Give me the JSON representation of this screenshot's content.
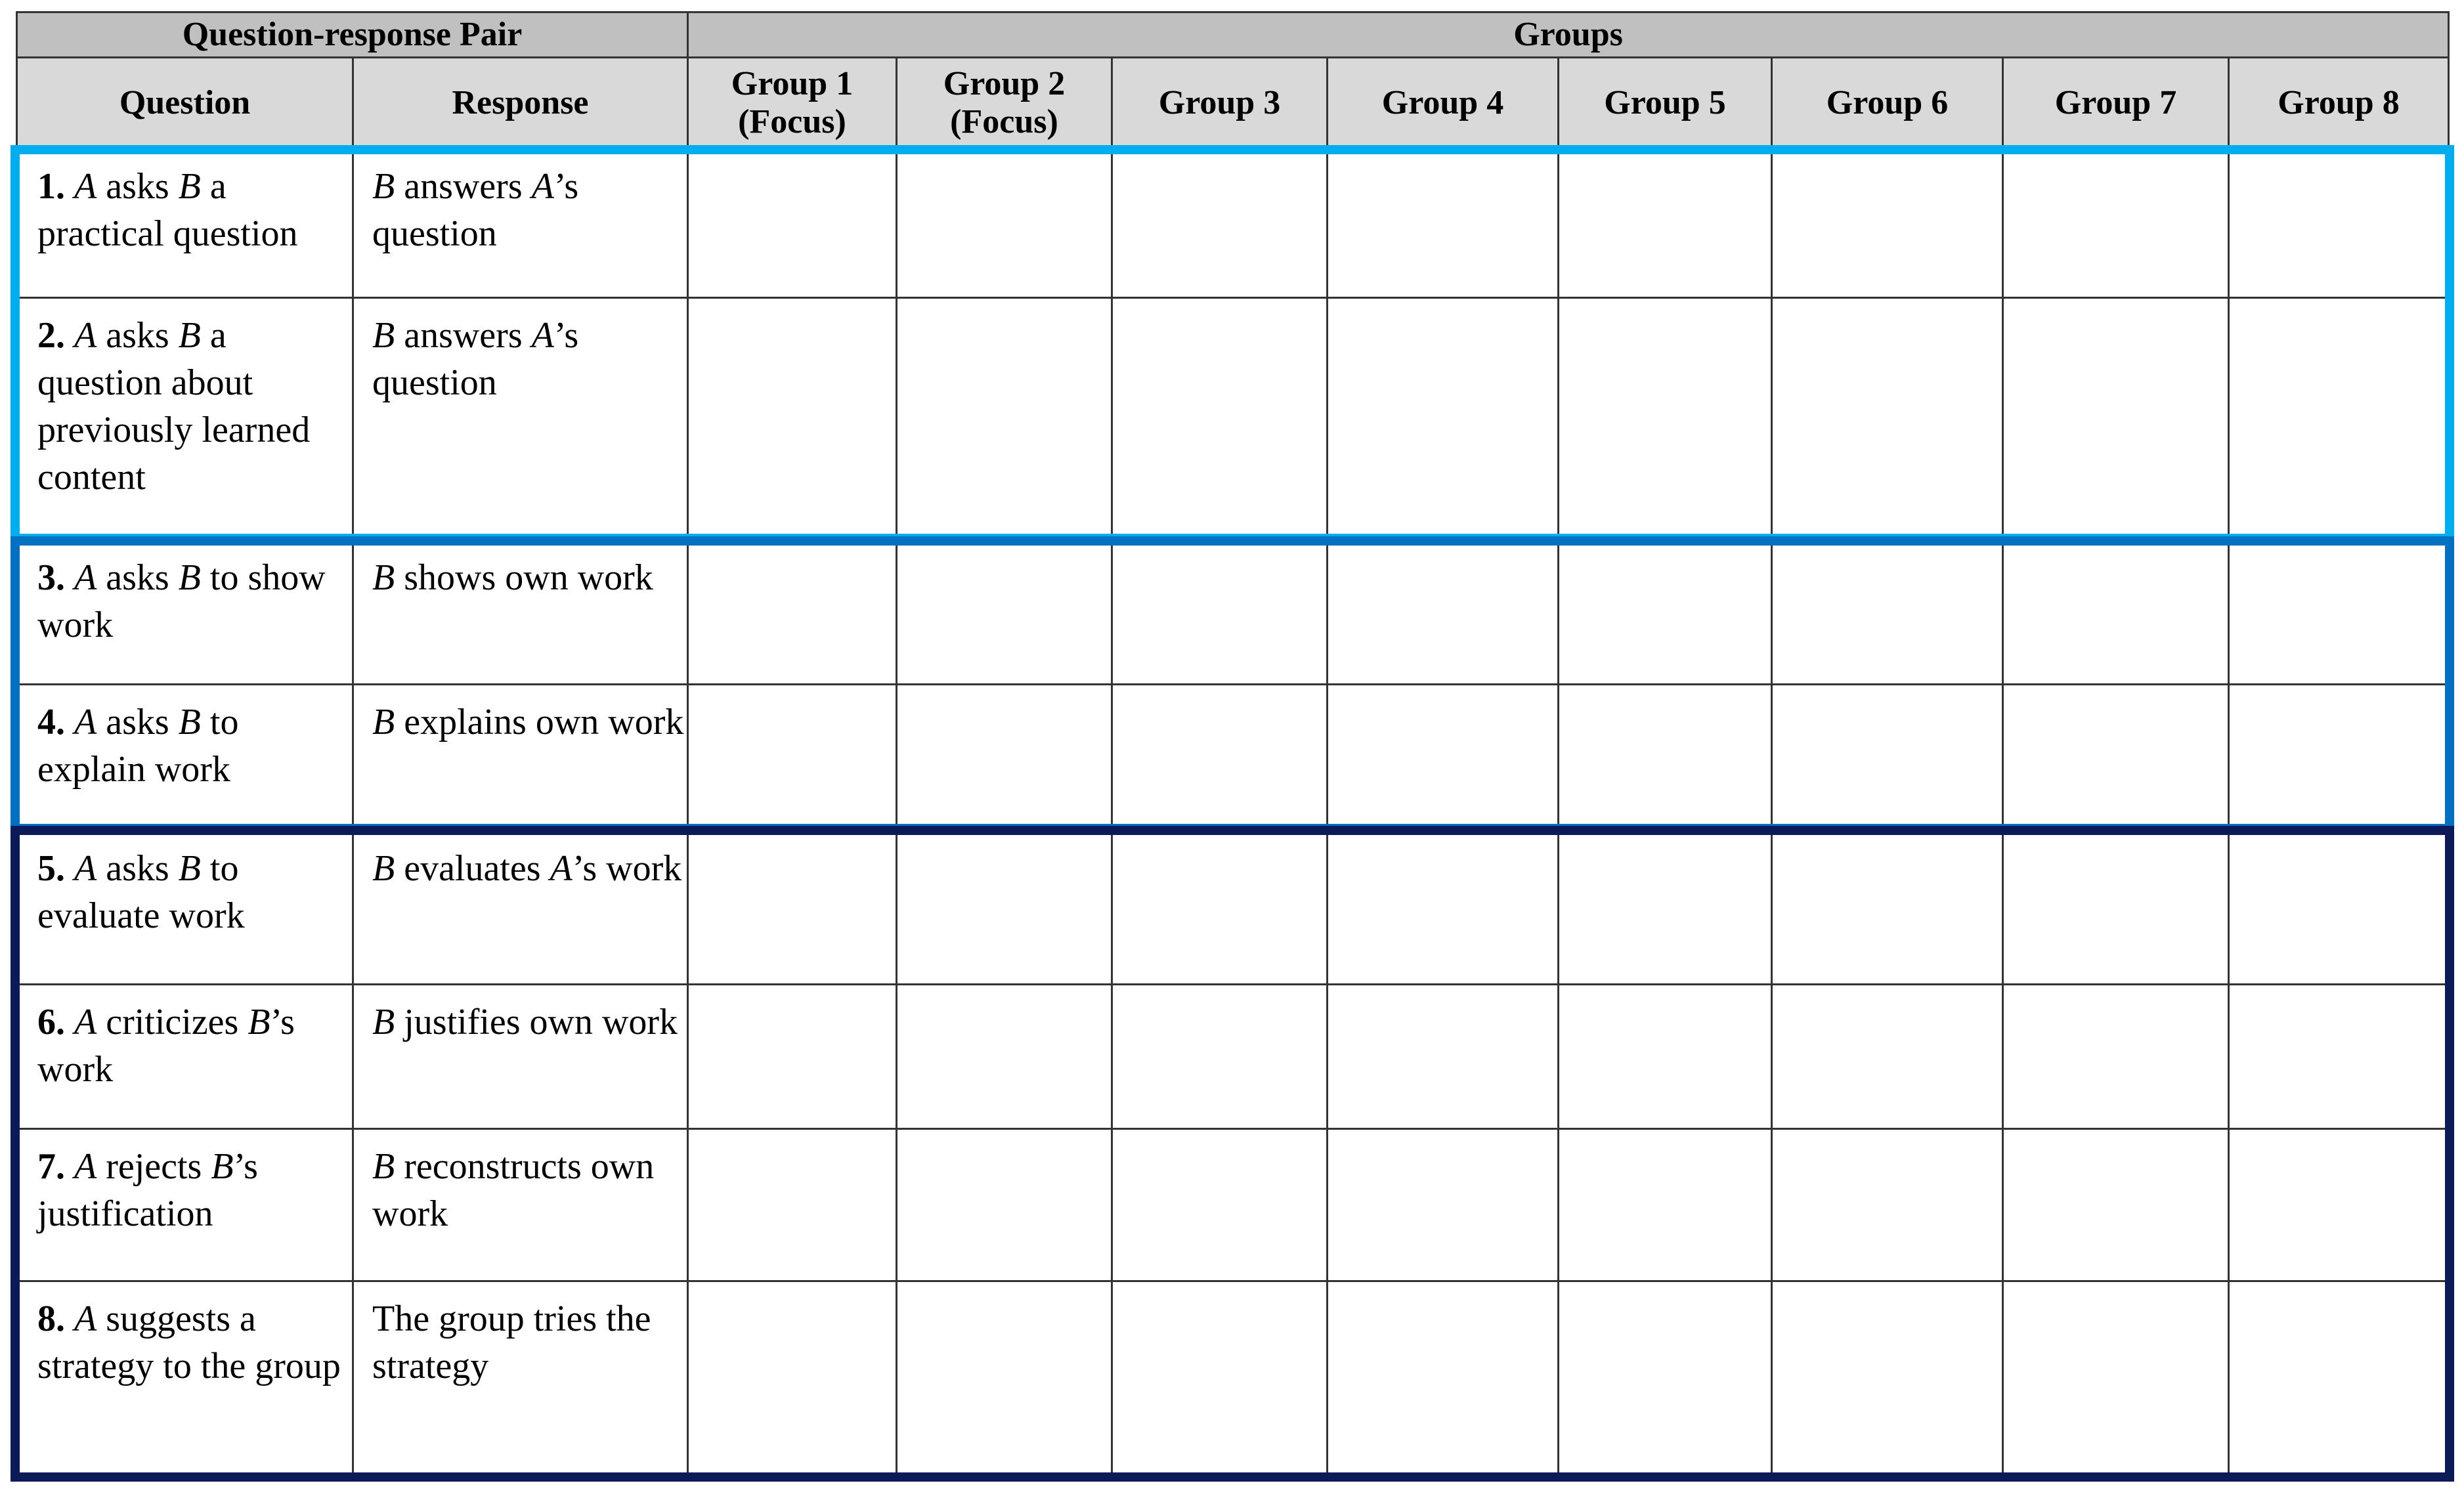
{
  "header": {
    "pair": "Question-response Pair",
    "groups": "Groups",
    "question": "Question",
    "response": "Response",
    "group_cols": [
      {
        "l1": "Group 1",
        "l2": "(Focus)"
      },
      {
        "l1": "Group 2",
        "l2": "(Focus)"
      },
      {
        "l1": "Group 3"
      },
      {
        "l1": "Group 4"
      },
      {
        "l1": "Group 5"
      },
      {
        "l1": "Group 6"
      },
      {
        "l1": "Group 7"
      },
      {
        "l1": "Group 8"
      }
    ]
  },
  "rows": [
    {
      "q": [
        {
          "t": "1. ",
          "b": true
        },
        {
          "t": "A",
          "i": true
        },
        {
          "t": " asks "
        },
        {
          "t": "B",
          "i": true
        },
        {
          "t": " a practical question"
        }
      ],
      "r": [
        {
          "t": "B",
          "i": true
        },
        {
          "t": " answers "
        },
        {
          "t": "A",
          "i": true
        },
        {
          "t": "’s question"
        }
      ]
    },
    {
      "q": [
        {
          "t": "2. ",
          "b": true
        },
        {
          "t": "A",
          "i": true
        },
        {
          "t": " asks "
        },
        {
          "t": "B",
          "i": true
        },
        {
          "t": " a question about previously learned content"
        }
      ],
      "r": [
        {
          "t": "B",
          "i": true
        },
        {
          "t": " answers "
        },
        {
          "t": "A",
          "i": true
        },
        {
          "t": "’s question"
        }
      ]
    },
    {
      "q": [
        {
          "t": "3. ",
          "b": true
        },
        {
          "t": "A",
          "i": true
        },
        {
          "t": " asks "
        },
        {
          "t": "B",
          "i": true
        },
        {
          "t": " to show work"
        }
      ],
      "r": [
        {
          "t": "B",
          "i": true
        },
        {
          "t": " shows own work"
        }
      ]
    },
    {
      "q": [
        {
          "t": "4. ",
          "b": true
        },
        {
          "t": "A",
          "i": true
        },
        {
          "t": " asks "
        },
        {
          "t": "B",
          "i": true
        },
        {
          "t": " to explain work"
        }
      ],
      "r": [
        {
          "t": "B",
          "i": true
        },
        {
          "t": " explains own work"
        }
      ]
    },
    {
      "q": [
        {
          "t": "5. ",
          "b": true
        },
        {
          "t": "A",
          "i": true
        },
        {
          "t": " asks "
        },
        {
          "t": "B",
          "i": true
        },
        {
          "t": " to evaluate work"
        }
      ],
      "r": [
        {
          "t": "B",
          "i": true
        },
        {
          "t": " evaluates "
        },
        {
          "t": "A",
          "i": true
        },
        {
          "t": "’s work"
        }
      ]
    },
    {
      "q": [
        {
          "t": "6. ",
          "b": true
        },
        {
          "t": "A",
          "i": true
        },
        {
          "t": " criticizes "
        },
        {
          "t": "B",
          "i": true
        },
        {
          "t": "’s work"
        }
      ],
      "r": [
        {
          "t": "B",
          "i": true
        },
        {
          "t": " justifies own work"
        }
      ]
    },
    {
      "q": [
        {
          "t": "7. ",
          "b": true
        },
        {
          "t": "A",
          "i": true
        },
        {
          "t": " rejects "
        },
        {
          "t": "B",
          "i": true
        },
        {
          "t": "’s justification"
        }
      ],
      "r": [
        {
          "t": "B",
          "i": true
        },
        {
          "t": " reconstructs own work"
        }
      ]
    },
    {
      "q": [
        {
          "t": "8. ",
          "b": true
        },
        {
          "t": "A",
          "i": true
        },
        {
          "t": " suggests a strategy to the group"
        }
      ],
      "r": [
        {
          "t": "The group tries the strategy"
        }
      ]
    }
  ],
  "colors": {
    "band1": "#00aeef",
    "band2": "#0070c0",
    "band3": "#0c1a5a"
  }
}
